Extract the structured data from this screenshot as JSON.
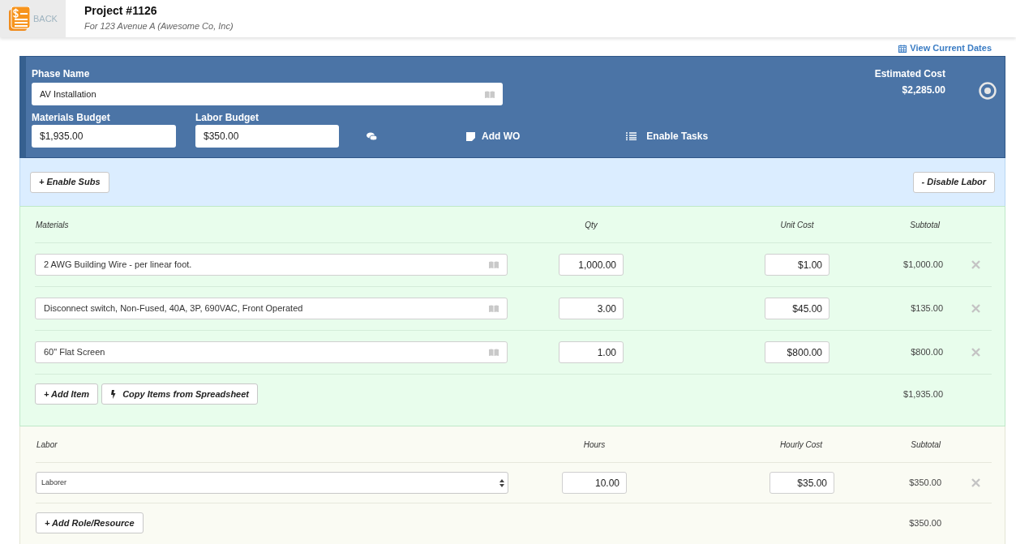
{
  "header": {
    "back_label": "BACK",
    "title": "Project #1126",
    "subtitle": "For 123 Avenue A (Awesome Co, Inc)"
  },
  "view_dates_link": "View Current Dates",
  "phase": {
    "name_label": "Phase Name",
    "name_value": "AV Installation",
    "estimated_cost_label": "Estimated Cost",
    "estimated_cost": "$2,285.00",
    "materials_budget_label": "Materials Budget",
    "materials_budget": "$1,935.00",
    "labor_budget_label": "Labor Budget",
    "labor_budget": "$350.00",
    "add_wo": "Add WO",
    "enable_tasks": "Enable Tasks"
  },
  "subs_bar": {
    "enable_subs": "+ Enable Subs",
    "disable_labor": "- Disable Labor"
  },
  "materials": {
    "columns": [
      "Materials",
      "Qty",
      "Unit Cost",
      "Subtotal"
    ],
    "rows": [
      {
        "name": "2 AWG Building Wire - per linear foot.",
        "qty": "1,000.00",
        "unit_cost": "$1.00",
        "subtotal": "$1,000.00"
      },
      {
        "name": "Disconnect switch, Non-Fused, 40A, 3P, 690VAC, Front Operated",
        "qty": "3.00",
        "unit_cost": "$45.00",
        "subtotal": "$135.00"
      },
      {
        "name": "60\" Flat Screen",
        "qty": "1.00",
        "unit_cost": "$800.00",
        "subtotal": "$800.00"
      }
    ],
    "add_item": "+ Add Item",
    "copy_items": "Copy Items from Spreadsheet",
    "total": "$1,935.00"
  },
  "labor": {
    "columns": [
      "Labor",
      "Hours",
      "Hourly Cost",
      "Subtotal"
    ],
    "rows": [
      {
        "role": "Laborer",
        "hours": "10.00",
        "hourly_cost": "$35.00",
        "subtotal": "$350.00"
      }
    ],
    "add_role": "+ Add Role/Resource",
    "total": "$350.00"
  }
}
